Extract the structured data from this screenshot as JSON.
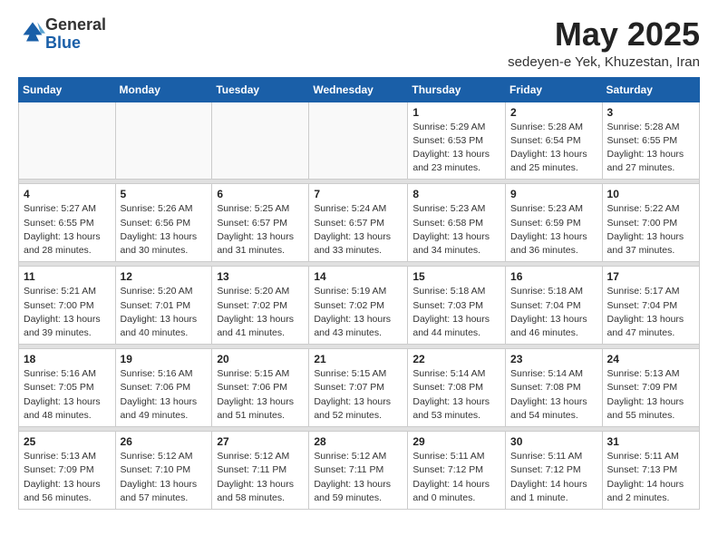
{
  "logo": {
    "general": "General",
    "blue": "Blue"
  },
  "header": {
    "month": "May 2025",
    "location": "sedeyen-e Yek, Khuzestan, Iran"
  },
  "days_of_week": [
    "Sunday",
    "Monday",
    "Tuesday",
    "Wednesday",
    "Thursday",
    "Friday",
    "Saturday"
  ],
  "weeks": [
    [
      {
        "day": "",
        "info": ""
      },
      {
        "day": "",
        "info": ""
      },
      {
        "day": "",
        "info": ""
      },
      {
        "day": "",
        "info": ""
      },
      {
        "day": "1",
        "info": "Sunrise: 5:29 AM\nSunset: 6:53 PM\nDaylight: 13 hours\nand 23 minutes."
      },
      {
        "day": "2",
        "info": "Sunrise: 5:28 AM\nSunset: 6:54 PM\nDaylight: 13 hours\nand 25 minutes."
      },
      {
        "day": "3",
        "info": "Sunrise: 5:28 AM\nSunset: 6:55 PM\nDaylight: 13 hours\nand 27 minutes."
      }
    ],
    [
      {
        "day": "4",
        "info": "Sunrise: 5:27 AM\nSunset: 6:55 PM\nDaylight: 13 hours\nand 28 minutes."
      },
      {
        "day": "5",
        "info": "Sunrise: 5:26 AM\nSunset: 6:56 PM\nDaylight: 13 hours\nand 30 minutes."
      },
      {
        "day": "6",
        "info": "Sunrise: 5:25 AM\nSunset: 6:57 PM\nDaylight: 13 hours\nand 31 minutes."
      },
      {
        "day": "7",
        "info": "Sunrise: 5:24 AM\nSunset: 6:57 PM\nDaylight: 13 hours\nand 33 minutes."
      },
      {
        "day": "8",
        "info": "Sunrise: 5:23 AM\nSunset: 6:58 PM\nDaylight: 13 hours\nand 34 minutes."
      },
      {
        "day": "9",
        "info": "Sunrise: 5:23 AM\nSunset: 6:59 PM\nDaylight: 13 hours\nand 36 minutes."
      },
      {
        "day": "10",
        "info": "Sunrise: 5:22 AM\nSunset: 7:00 PM\nDaylight: 13 hours\nand 37 minutes."
      }
    ],
    [
      {
        "day": "11",
        "info": "Sunrise: 5:21 AM\nSunset: 7:00 PM\nDaylight: 13 hours\nand 39 minutes."
      },
      {
        "day": "12",
        "info": "Sunrise: 5:20 AM\nSunset: 7:01 PM\nDaylight: 13 hours\nand 40 minutes."
      },
      {
        "day": "13",
        "info": "Sunrise: 5:20 AM\nSunset: 7:02 PM\nDaylight: 13 hours\nand 41 minutes."
      },
      {
        "day": "14",
        "info": "Sunrise: 5:19 AM\nSunset: 7:02 PM\nDaylight: 13 hours\nand 43 minutes."
      },
      {
        "day": "15",
        "info": "Sunrise: 5:18 AM\nSunset: 7:03 PM\nDaylight: 13 hours\nand 44 minutes."
      },
      {
        "day": "16",
        "info": "Sunrise: 5:18 AM\nSunset: 7:04 PM\nDaylight: 13 hours\nand 46 minutes."
      },
      {
        "day": "17",
        "info": "Sunrise: 5:17 AM\nSunset: 7:04 PM\nDaylight: 13 hours\nand 47 minutes."
      }
    ],
    [
      {
        "day": "18",
        "info": "Sunrise: 5:16 AM\nSunset: 7:05 PM\nDaylight: 13 hours\nand 48 minutes."
      },
      {
        "day": "19",
        "info": "Sunrise: 5:16 AM\nSunset: 7:06 PM\nDaylight: 13 hours\nand 49 minutes."
      },
      {
        "day": "20",
        "info": "Sunrise: 5:15 AM\nSunset: 7:06 PM\nDaylight: 13 hours\nand 51 minutes."
      },
      {
        "day": "21",
        "info": "Sunrise: 5:15 AM\nSunset: 7:07 PM\nDaylight: 13 hours\nand 52 minutes."
      },
      {
        "day": "22",
        "info": "Sunrise: 5:14 AM\nSunset: 7:08 PM\nDaylight: 13 hours\nand 53 minutes."
      },
      {
        "day": "23",
        "info": "Sunrise: 5:14 AM\nSunset: 7:08 PM\nDaylight: 13 hours\nand 54 minutes."
      },
      {
        "day": "24",
        "info": "Sunrise: 5:13 AM\nSunset: 7:09 PM\nDaylight: 13 hours\nand 55 minutes."
      }
    ],
    [
      {
        "day": "25",
        "info": "Sunrise: 5:13 AM\nSunset: 7:09 PM\nDaylight: 13 hours\nand 56 minutes."
      },
      {
        "day": "26",
        "info": "Sunrise: 5:12 AM\nSunset: 7:10 PM\nDaylight: 13 hours\nand 57 minutes."
      },
      {
        "day": "27",
        "info": "Sunrise: 5:12 AM\nSunset: 7:11 PM\nDaylight: 13 hours\nand 58 minutes."
      },
      {
        "day": "28",
        "info": "Sunrise: 5:12 AM\nSunset: 7:11 PM\nDaylight: 13 hours\nand 59 minutes."
      },
      {
        "day": "29",
        "info": "Sunrise: 5:11 AM\nSunset: 7:12 PM\nDaylight: 14 hours\nand 0 minutes."
      },
      {
        "day": "30",
        "info": "Sunrise: 5:11 AM\nSunset: 7:12 PM\nDaylight: 14 hours\nand 1 minute."
      },
      {
        "day": "31",
        "info": "Sunrise: 5:11 AM\nSunset: 7:13 PM\nDaylight: 14 hours\nand 2 minutes."
      }
    ]
  ]
}
